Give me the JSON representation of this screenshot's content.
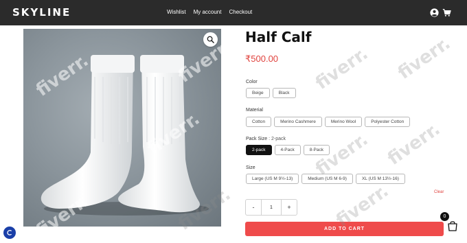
{
  "header": {
    "logo": "SKYLINE",
    "nav": [
      "Wishlist",
      "My account",
      "Checkout"
    ],
    "icons": [
      "user-icon",
      "cart-icon"
    ]
  },
  "product": {
    "title": "Half Calf",
    "price": "₹500.00",
    "image_alt": "white socks",
    "options": {
      "color": {
        "label": "Color",
        "values": [
          "Beige",
          "Black"
        ]
      },
      "material": {
        "label": "Material",
        "values": [
          "Cotton",
          "Merino Cashmere",
          "Merino Wool",
          "Polyester Cotton"
        ]
      },
      "pack_size": {
        "label": "Pack Size",
        "selected": ": 2-pack",
        "values": [
          "2-pack",
          "4-Pack",
          "8-Pack"
        ]
      },
      "size": {
        "label": "Size",
        "values": [
          "Large (US M 9½-13)",
          "Medium (US M 6-9)",
          "XL (US M 13½-16)"
        ]
      }
    },
    "clear_label": "Clear",
    "quantity": {
      "minus": "-",
      "value": "1",
      "plus": "+"
    },
    "add_to_cart": "ADD TO CART"
  },
  "cart_badge_count": "0",
  "watermark": "fiverr.",
  "colors": {
    "header_bg": "#2b2b2b",
    "accent": "#ef4b4b",
    "price": "#e0413c",
    "chat": "#1a3fa8"
  }
}
